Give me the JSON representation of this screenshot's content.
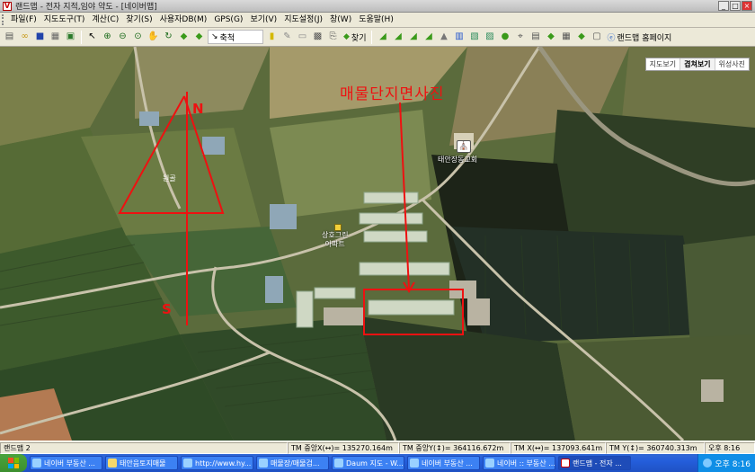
{
  "window": {
    "title": "랜드맵 - 전자 지적,임야 약도 - [네이버맵]",
    "app_icon": "landmap-icon",
    "controls": [
      "_",
      "□",
      "×"
    ]
  },
  "menu": [
    {
      "label": "파일(F)"
    },
    {
      "label": "지도도구(T)"
    },
    {
      "label": "계산(C)"
    },
    {
      "label": "찾기(S)"
    },
    {
      "label": "사용자DB(M)"
    },
    {
      "label": "GPS(G)"
    },
    {
      "label": "보기(V)"
    },
    {
      "label": "지도설정(J)"
    },
    {
      "label": "창(W)"
    },
    {
      "label": "도움말(H)"
    }
  ],
  "toolbar": {
    "search_label": "축척",
    "find_label": "찾기",
    "homepage_label": "랜드맵 홈페이지"
  },
  "map": {
    "map_types": [
      {
        "label": "지도보기",
        "active": false
      },
      {
        "label": "겹쳐보기",
        "active": true
      },
      {
        "label": "위성사진",
        "active": false
      }
    ],
    "labels": {
      "annotation": "매물단지면사진",
      "church": "태안장동교회",
      "apartment_line1": "상호그린",
      "apartment_line2": "아파트",
      "village": "원골",
      "north": "N",
      "south": "S"
    },
    "annotation_color": "#ee1111"
  },
  "status": {
    "app": "랜드맵 2",
    "tm_center_x": "TM 중앙X(↔)= 135270.164m",
    "tm_center_y": "TM 중앙Y(↕)= 364116.672m",
    "tm_x": "TM X(↔)= 137093.641m",
    "tm_y": "TM Y(↕)= 360740.313m",
    "time": "오후 8:16"
  },
  "taskbar": {
    "tasks": [
      {
        "label": "네이버 부동산 ...",
        "active": false
      },
      {
        "label": "태안음토지매물",
        "active": false
      },
      {
        "label": "http://www.hy...",
        "active": false
      },
      {
        "label": "매물장/매물검...",
        "active": false
      },
      {
        "label": "Daum 지도 - W...",
        "active": false
      },
      {
        "label": "네이버 부동산 ...",
        "active": false
      },
      {
        "label": "네이버 :: 부동산 ...",
        "active": false
      },
      {
        "label": "랜드맵 - 전자 ...",
        "active": true
      }
    ],
    "clock": "오후 8:16"
  }
}
